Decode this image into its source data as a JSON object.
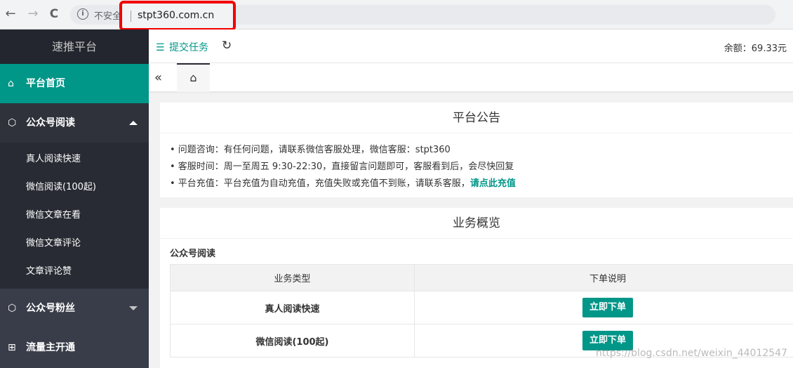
{
  "browser": {
    "back": "←",
    "forward": "→",
    "reload": "C",
    "insecure_label": "不安全",
    "url": "stpt360.com.cn"
  },
  "sidebar": {
    "logo": "速推平台",
    "items": [
      {
        "label": "平台首页",
        "icon": "home-icon",
        "glyph": "⌂"
      },
      {
        "label": "公众号阅读",
        "icon": "cube-icon",
        "glyph": "⬡"
      },
      {
        "label": "公众号粉丝",
        "icon": "cube-icon",
        "glyph": "⬡"
      },
      {
        "label": "流量主开通",
        "icon": "apps-icon",
        "glyph": "⊞"
      }
    ],
    "subitems": [
      "真人阅读快速",
      "微信阅读(100起)",
      "微信文章在看",
      "微信文章评论",
      "文章评论赞"
    ]
  },
  "header": {
    "submit_task": "提交任务",
    "balance": "余额：69.33元"
  },
  "notice": {
    "title": "平台公告",
    "line1": "• 问题咨询：有任何问题，请联系微信客服处理，微信客服：stpt360",
    "line2": "• 客服时间：周一至周五 9:30-22:30，直接留言问题即可，客服看到后，会尽快回复",
    "line3_text": "• 平台充值：平台充值为自动充值，充值失败或充值不到账，请联系客服，",
    "line3_link": "请点此充值"
  },
  "overview": {
    "title": "业务概览",
    "section": "公众号阅读",
    "columns": [
      "业务类型",
      "下单说明"
    ],
    "rows": [
      {
        "type": "真人阅读快速",
        "button": "立即下单"
      },
      {
        "type": "微信阅读(100起)",
        "button": "立即下单"
      }
    ]
  },
  "watermark": "https://blog.csdn.net/weixin_44012547",
  "colors": {
    "accent": "#009688",
    "sidebar": "#393d49",
    "highlight": "#f20000"
  }
}
